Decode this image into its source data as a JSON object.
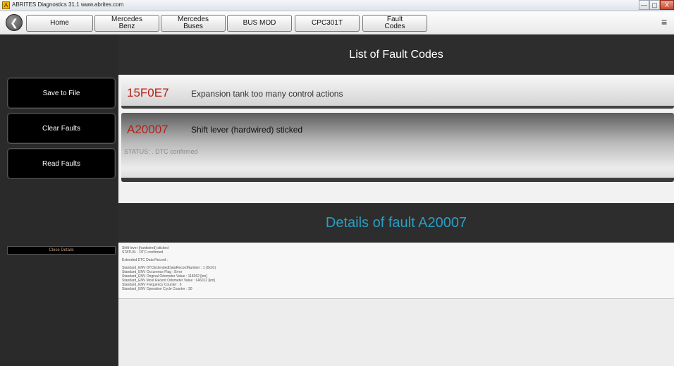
{
  "window": {
    "title": "ABRITES Diagnostics 31.1  www.abrites.com",
    "controls": {
      "minimize": "—",
      "maximize": "▢",
      "close": "X"
    }
  },
  "nav": {
    "back_icon": "arrow-left-icon",
    "tabs": [
      {
        "label_line1": "Home",
        "label_line2": ""
      },
      {
        "label_line1": "Mercedes",
        "label_line2": "Benz"
      },
      {
        "label_line1": "Mercedes",
        "label_line2": "Buses"
      },
      {
        "label_line1": "BUS MOD",
        "label_line2": ""
      },
      {
        "label_line1": "CPC301T",
        "label_line2": ""
      },
      {
        "label_line1": "Fault",
        "label_line2": "Codes"
      }
    ],
    "menu_icon": "≡"
  },
  "sidebar": {
    "save": "Save to File",
    "clear": "Clear Faults",
    "read": "Read Faults",
    "close_details": "Close Details"
  },
  "list": {
    "title": "List of Fault Codes",
    "faults": [
      {
        "code": "15F0E7",
        "description": "Expansion tank too many control actions"
      },
      {
        "code": "A20007",
        "description": "Shift lever (hardwired) sticked",
        "status": "STATUS: . DTC confirmed"
      }
    ]
  },
  "details": {
    "title": "Details of fault A20007",
    "lines": [
      "Shift lever (hardwired) sticked",
      "STATUS: . DTC confirmed",
      "",
      "Extended DTC Data Record :",
      "",
      "Standard_ENV DTCExtendedDataRecordNumber : 1 (0x01)",
      "Standard_ENV Occurence Flag : Error",
      "Standard_ENV Original Odometer Value : 118362 [km]",
      "Standard_ENV Most Recent Odometer Value : 146012 [km]",
      "Standard_ENV Frequency Counter : 6",
      "Standard_ENV Operation Cycle Counter : 30"
    ]
  }
}
